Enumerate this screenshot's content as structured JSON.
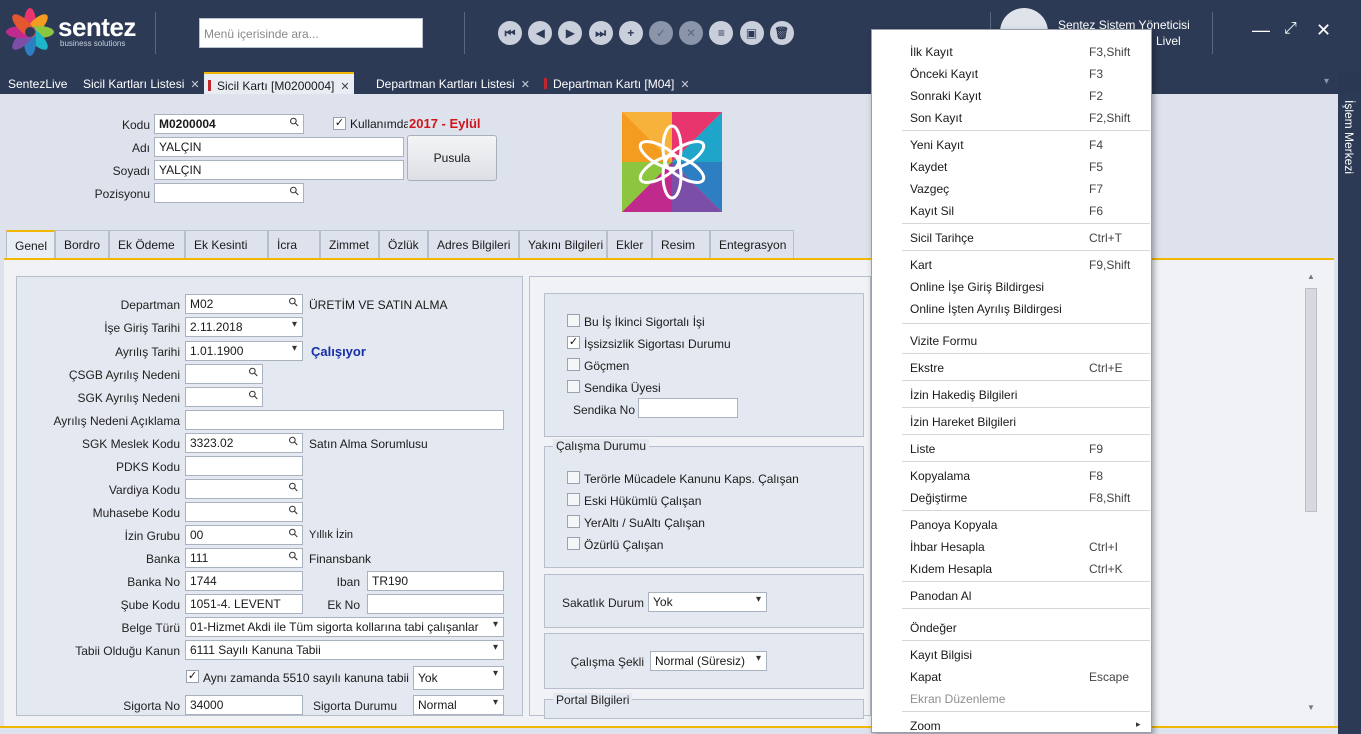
{
  "brand": {
    "name": "sentez",
    "tagline": "business solutions"
  },
  "search": {
    "placeholder": "Menü içerisinde ara..."
  },
  "toolbar": {
    "icons": [
      "first-record-icon",
      "prev-record-icon",
      "next-record-icon",
      "last-record-icon",
      "add-icon",
      "approve-icon",
      "cancel-icon",
      "list-icon",
      "card-icon",
      "delete-icon"
    ],
    "glyphs": [
      "⏮",
      "◀",
      "▶",
      "⏭",
      "+",
      "✓",
      "✕",
      "≡",
      "▣",
      "🗑"
    ]
  },
  "user": {
    "name": "Sentez Sistem Yöneticisi",
    "subtitle": "Livel"
  },
  "tabs": [
    {
      "label": "SentezLive"
    },
    {
      "label": "Sicil Kartları Listesi",
      "close": "✕"
    },
    {
      "label": "Sicil Kartı [M0200004]",
      "close": "✕"
    },
    {
      "label": "Departman Kartları Listesi",
      "close": "✕"
    },
    {
      "label": "Departman Kartı [M04]",
      "close": "✕"
    }
  ],
  "rail": {
    "label": "İşlem Merkezi"
  },
  "header": {
    "kod_label": "Kodu",
    "kod": "M0200004",
    "kullanimda": "Kullanımda",
    "period": "2017 - Eylül",
    "adi_label": "Adı",
    "adi": "YALÇIN",
    "soyadi_label": "Soyadı",
    "soyadi": "YALÇIN",
    "pozisyon_label": "Pozisyonu",
    "pozisyon": "",
    "pusula": "Pusula"
  },
  "subtabs": [
    "Genel",
    "Bordro",
    "Ek Ödeme",
    "Ek Kesinti",
    "İcra",
    "Zimmet",
    "Özlük",
    "Adres Bilgileri",
    "Yakını Bilgileri",
    "Ekler",
    "Resim",
    "Entegrasyon"
  ],
  "form": {
    "departman_label": "Departman",
    "departman": "M02",
    "departman_name": "ÜRETİM VE SATIN ALMA",
    "ise_giris_label": "İşe Giriş Tarihi",
    "ise_giris": "2.11.2018",
    "ayrilis_label": "Ayrılış Tarihi",
    "ayrilis": "1.01.1900",
    "status": "Çalışıyor",
    "csgb_label": "ÇSGB Ayrılış Nedeni",
    "sgk_ayrilis_label": "SGK Ayrılış Nedeni",
    "ayrilis_aciklama_label": "Ayrılış Nedeni Açıklama",
    "sgk_meslek_label": "SGK Meslek Kodu",
    "sgk_meslek": "3323.02",
    "sgk_meslek_name": "Satın Alma Sorumlusu",
    "pdks_label": "PDKS Kodu",
    "vardiya_label": "Vardiya Kodu",
    "muhasebe_label": "Muhasebe Kodu",
    "izin_grubu_label": "İzin Grubu",
    "izin_grubu": "00",
    "izin_grubu_name": "Yıllık İzin",
    "banka_label": "Banka",
    "banka": "111",
    "banka_name": "Finansbank",
    "banka_no_label": "Banka No",
    "banka_no": "1744",
    "iban_label": "Iban",
    "iban": "TR190",
    "sube_label": "Şube Kodu",
    "sube": "1051-4. LEVENT",
    "ek_no_label": "Ek No",
    "belge_label": "Belge Türü",
    "belge": "01-Hizmet Akdi ile Tüm sigorta kollarına tabi çalışanlar",
    "kanun_label": "Tabii Olduğu Kanun",
    "kanun": "6111 Sayılı Kanuna Tabii",
    "ayni_zamanda": "Aynı zamanda 5510 sayılı kanuna tabii",
    "ayni_zamanda_val": "Yok",
    "sigorta_no_label": "Sigorta No",
    "sigorta_no": "34000",
    "sigorta_durumu_label": "Sigorta Durumu",
    "sigorta_durumu": "Normal"
  },
  "right": {
    "ikinci_sigortali": "Bu İş İkinci Sigortalı İşi",
    "issizlik": "İşsizsizlik Sigortası Durumu",
    "gocmen": "Göçmen",
    "sendika_uyesi": "Sendika Üyesi",
    "sendika_no": "Sendika No",
    "calisma_durumu_title": "Çalışma Durumu",
    "teror": "Terörle Mücadele Kanunu Kaps. Çalışan",
    "eski_hukumlu": "Eski Hükümlü Çalışan",
    "yeralti": "YerAltı / SuAltı Çalışan",
    "ozurlu": "Özürlü Çalışan",
    "sakatlik_label": "Sakatlık Durum",
    "sakatlik": "Yok",
    "calisma_sekli_label": "Çalışma Şekli",
    "calisma_sekli": "Normal (Süresiz)",
    "portal_title": "Portal Bilgileri"
  },
  "context_menu": [
    {
      "label": "İlk Kayıt",
      "shortcut": "F3,Shift"
    },
    {
      "label": "Önceki Kayıt",
      "shortcut": "F3"
    },
    {
      "label": "Sonraki Kayıt",
      "shortcut": "F2"
    },
    {
      "label": "Son Kayıt",
      "shortcut": "F2,Shift"
    },
    {
      "label": "Yeni Kayıt",
      "shortcut": "F4"
    },
    {
      "label": "Kaydet",
      "shortcut": "F5"
    },
    {
      "label": "Vazgeç",
      "shortcut": "F7"
    },
    {
      "label": "Kayıt Sil",
      "shortcut": "F6"
    },
    {
      "label": "Sicil Tarihçe",
      "shortcut": "Ctrl+T"
    },
    {
      "label": "Kart",
      "shortcut": "F9,Shift"
    },
    {
      "label": "Online İşe Giriş Bildirgesi",
      "shortcut": ""
    },
    {
      "label": "Online İşten Ayrılış Bildirgesi",
      "shortcut": ""
    },
    {
      "label": "Vizite Formu",
      "shortcut": ""
    },
    {
      "label": "Ekstre",
      "shortcut": "Ctrl+E"
    },
    {
      "label": "İzin Hakediş Bilgileri",
      "shortcut": ""
    },
    {
      "label": "İzin Hareket Bilgileri",
      "shortcut": ""
    },
    {
      "label": "Liste",
      "shortcut": "F9"
    },
    {
      "label": "Kopyalama",
      "shortcut": "F8"
    },
    {
      "label": "Değiştirme",
      "shortcut": "F8,Shift"
    },
    {
      "label": "Panoya Kopyala",
      "shortcut": ""
    },
    {
      "label": "İhbar Hesapla",
      "shortcut": "Ctrl+I"
    },
    {
      "label": "Kıdem Hesapla",
      "shortcut": "Ctrl+K"
    },
    {
      "label": "Panodan Al",
      "shortcut": ""
    },
    {
      "label": "Öndeğer",
      "shortcut": ""
    },
    {
      "label": "Kayıt Bilgisi",
      "shortcut": ""
    },
    {
      "label": "Kapat",
      "shortcut": "Escape"
    },
    {
      "label": "Ekran Düzenleme",
      "shortcut": ""
    },
    {
      "label": "Zoom",
      "shortcut": ""
    }
  ],
  "colors": {
    "accent": "#f0b800",
    "topbar": "#2d3a55",
    "period_red": "#d0161c",
    "status_blue": "#1530a8"
  }
}
